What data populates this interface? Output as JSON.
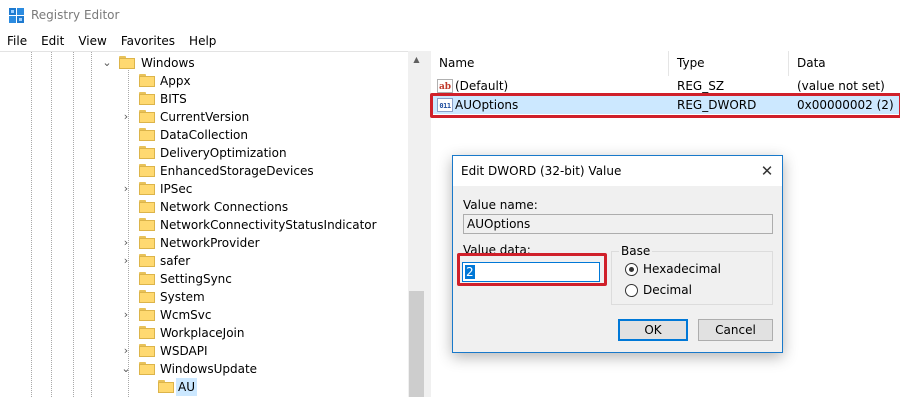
{
  "window": {
    "title": "Registry Editor"
  },
  "menu": [
    "File",
    "Edit",
    "View",
    "Favorites",
    "Help"
  ],
  "tree": {
    "parent": "Windows",
    "items": [
      {
        "label": "Appx",
        "expandable": false
      },
      {
        "label": "BITS",
        "expandable": false
      },
      {
        "label": "CurrentVersion",
        "expandable": true
      },
      {
        "label": "DataCollection",
        "expandable": false
      },
      {
        "label": "DeliveryOptimization",
        "expandable": false
      },
      {
        "label": "EnhancedStorageDevices",
        "expandable": false
      },
      {
        "label": "IPSec",
        "expandable": true
      },
      {
        "label": "Network Connections",
        "expandable": false
      },
      {
        "label": "NetworkConnectivityStatusIndicator",
        "expandable": false
      },
      {
        "label": "NetworkProvider",
        "expandable": true
      },
      {
        "label": "safer",
        "expandable": true
      },
      {
        "label": "SettingSync",
        "expandable": false
      },
      {
        "label": "System",
        "expandable": false
      },
      {
        "label": "WcmSvc",
        "expandable": true
      },
      {
        "label": "WorkplaceJoin",
        "expandable": false
      },
      {
        "label": "WSDAPI",
        "expandable": true
      },
      {
        "label": "WindowsUpdate",
        "expandable": true,
        "expanded": true
      }
    ],
    "selected_child": "AU"
  },
  "values": {
    "columns": [
      "Name",
      "Type",
      "Data"
    ],
    "rows": [
      {
        "name": "(Default)",
        "type": "REG_SZ",
        "data": "(value not set)",
        "icon": "string-value-icon",
        "icon_text": "ab"
      },
      {
        "name": "AUOptions",
        "type": "REG_DWORD",
        "data": "0x00000002 (2)",
        "icon": "dword-value-icon",
        "icon_text": "011",
        "selected": true
      }
    ]
  },
  "dialog": {
    "title": "Edit DWORD (32-bit) Value",
    "close_glyph": "✕",
    "value_name_label": "Value name:",
    "value_name": "AUOptions",
    "value_data_label": "Value data:",
    "value_data": "2",
    "base_label": "Base",
    "base_options": [
      {
        "label": "Hexadecimal",
        "selected": true
      },
      {
        "label": "Decimal",
        "selected": false
      }
    ],
    "ok_label": "OK",
    "cancel_label": "Cancel"
  },
  "colors": {
    "highlight_red": "#d0202a",
    "selection_blue": "#cce8ff",
    "accent": "#0078d7"
  }
}
